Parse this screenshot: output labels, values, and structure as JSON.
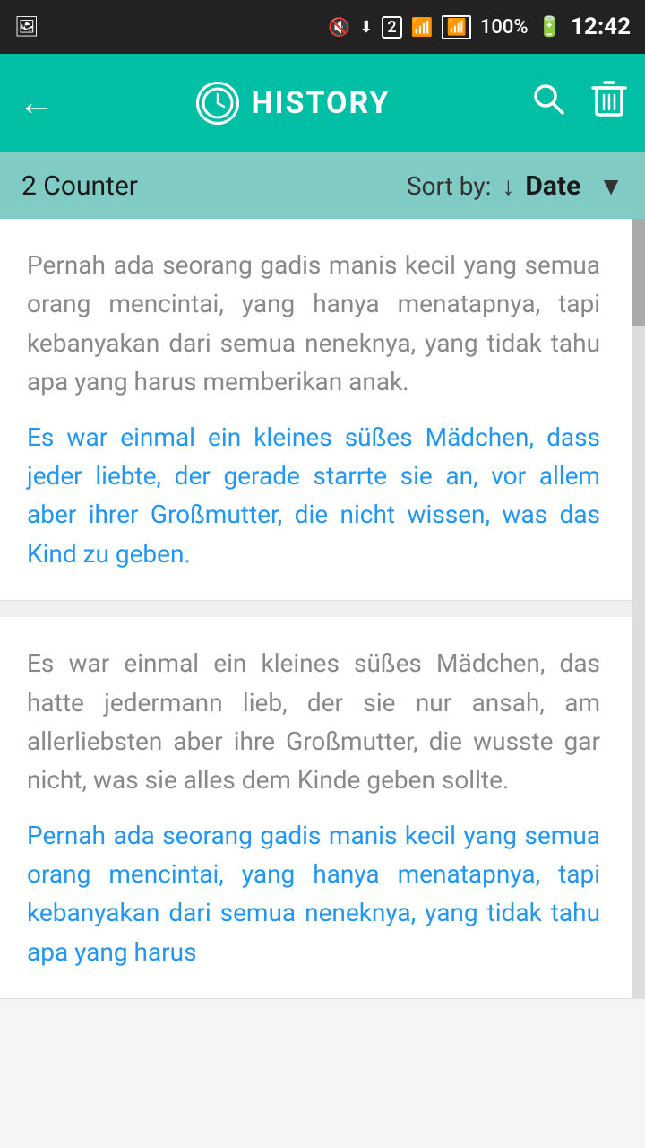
{
  "statusBar": {
    "leftIcon": "📷",
    "muteIcon": "🔇",
    "wifiIcon": "WiFi",
    "simIcon": "2",
    "signalIcon": "Signal",
    "batteryPercent": "100%",
    "batteryIcon": "🔋",
    "time": "12:42"
  },
  "toolbar": {
    "backLabel": "←",
    "clockIcon": "🕐",
    "title": "HISTORY",
    "searchIcon": "search",
    "deleteIcon": "delete"
  },
  "filterBar": {
    "counterText": "2 Counter",
    "sortByLabel": "Sort by:",
    "sortValue": "Date"
  },
  "cards": [
    {
      "id": 1,
      "grayText": "Pernah ada seorang gadis manis kecil yang semua orang mencintai, yang hanya menatapnya, tapi kebanyakan dari semua neneknya, yang tidak tahu apa yang harus memberikan anak.",
      "blueText": "Es war einmal ein kleines süßes Mädchen, dass jeder liebte, der gerade starrte sie an, vor allem aber ihrer Großmutter, die nicht wissen, was das Kind zu geben."
    },
    {
      "id": 2,
      "grayText": "Es war einmal ein kleines süßes Mädchen, das hatte jedermann lieb, der sie nur ansah, am allerliebsten aber ihre Großmutter, die wusste gar nicht, was sie alles dem Kinde geben sollte.",
      "blueText": "Pernah ada seorang gadis manis kecil yang semua orang mencintai, yang hanya menatapnya, tapi kebanyakan dari semua neneknya, yang tidak tahu apa yang harus"
    }
  ]
}
